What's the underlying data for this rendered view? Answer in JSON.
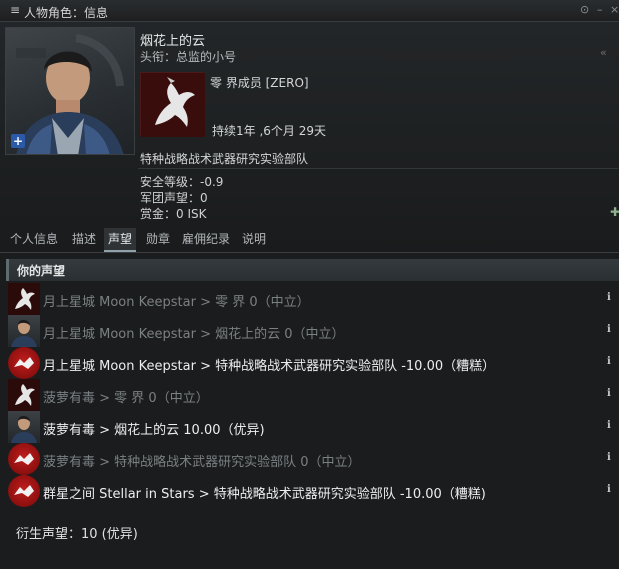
{
  "window": {
    "title": "人物角色：信息",
    "buttons": [
      "⊙",
      "–",
      "×"
    ]
  },
  "character": {
    "name": "烟花上的云",
    "title": "头衔：总监的小号",
    "corporation": "零 界成员 [ZERO]",
    "duration": "持续1年 ,6个月 29天",
    "alliance": "特种战略战术武器研究实验部队",
    "security": "安全等级：-0.9",
    "faction_standing": "军团声望：0",
    "bounty": "赏金：0 ISK"
  },
  "tabs": [
    {
      "label": "个人信息",
      "active": false
    },
    {
      "label": "描述",
      "active": false
    },
    {
      "label": "声望",
      "active": true
    },
    {
      "label": "勋章",
      "active": false
    },
    {
      "label": "雇佣纪录",
      "active": false
    },
    {
      "label": "说明",
      "active": false
    }
  ],
  "standings": {
    "header": "你的声望",
    "rows": [
      {
        "icon": "horse",
        "text": "月上星城 Moon Keepstar > 零 界 0（中立）",
        "dim": true
      },
      {
        "icon": "person",
        "text": "月上星城 Moon Keepstar > 烟花上的云 0（中立）",
        "dim": true
      },
      {
        "icon": "alliance",
        "text": "月上星城 Moon Keepstar > 特种战略战术武器研究实验部队 -10.00（糟糕）",
        "dim": false
      },
      {
        "icon": "horse",
        "text": "菠萝有毒 > 零 界 0（中立）",
        "dim": true
      },
      {
        "icon": "person",
        "text": "菠萝有毒 > 烟花上的云 10.00（优异)",
        "dim": false
      },
      {
        "icon": "alliance",
        "text": "菠萝有毒 > 特种战略战术武器研究实验部队 0（中立）",
        "dim": true
      },
      {
        "icon": "alliance",
        "text": "群星之间 Stellar in Stars > 特种战略战术武器研究实验部队 -10.00（糟糕)",
        "dim": false
      }
    ],
    "derived": "衍生声望：10 (优异)"
  },
  "colors": {
    "background": "#141617",
    "accent_red": "#c21d1d",
    "text_bright": "#eceeef",
    "text_dim": "#7b8083"
  }
}
